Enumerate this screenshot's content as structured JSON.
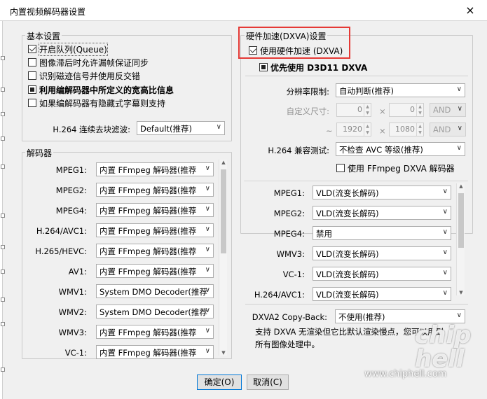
{
  "window": {
    "title": "内置视频解码器设置",
    "close_icon": "×"
  },
  "basic": {
    "title": "基本设置",
    "options": [
      {
        "label": "开启队列(Queue)",
        "state": "checked"
      },
      {
        "label": "图像滞后时允许漏帧保证同步",
        "state": "unchecked"
      },
      {
        "label": "识别磁迹信号并使用反交错",
        "state": "unchecked"
      },
      {
        "label": "利用编解码器中所定义的宽高比信息",
        "state": "indeterminate"
      },
      {
        "label": "如果编解码器有隐藏式字幕则支持",
        "state": "unchecked"
      }
    ],
    "deblock_label": "H.264 连续去块滤波:",
    "deblock_value": "Default(推荐)"
  },
  "decoders": {
    "title": "解码器",
    "rows": [
      {
        "label": "MPEG1:",
        "value": "内置 FFmpeg 解码器(推荐"
      },
      {
        "label": "MPEG2:",
        "value": "内置 FFmpeg 解码器(推荐"
      },
      {
        "label": "MPEG4:",
        "value": "内置 FFmpeg 解码器(推荐"
      },
      {
        "label": "H.264/AVC1:",
        "value": "内置 FFmpeg 解码器(推荐"
      },
      {
        "label": "H.265/HEVC:",
        "value": "内置 FFmpeg 解码器(推荐"
      },
      {
        "label": "AV1:",
        "value": "内置 FFmpeg 解码器(推荐"
      },
      {
        "label": "WMV1:",
        "value": "System DMO Decoder(推荐"
      },
      {
        "label": "WMV2:",
        "value": "System DMO Decoder(推荐"
      },
      {
        "label": "WMV3:",
        "value": "内置 FFmpeg 解码器(推荐"
      },
      {
        "label": "VC-1:",
        "value": "内置 FFmpeg 解码器(推荐"
      }
    ]
  },
  "hw": {
    "title": "硬件加速(DXVA)设置",
    "enable_label": "使用硬件加速 (DXVA)",
    "d3d11_label": "优先使用 D3D11 DXVA",
    "resolution_label": "分辨率限制:",
    "resolution_value": "自动判断(推荐)",
    "custom_size_label": "自定义尺寸:",
    "min_w": "0",
    "min_h": "0",
    "max_w": "1920",
    "max_h": "1080",
    "times": "×",
    "tilde": "~",
    "and1": "AND",
    "and2": "AND",
    "compat_label": "H.264 兼容测试:",
    "compat_value": "不检查 AVC 等级(推荐)",
    "ffmpeg_dxva_label": "使用 FFmpeg DXVA 解码器",
    "codec_rows": [
      {
        "label": "MPEG1:",
        "value": "VLD(流变长解码)"
      },
      {
        "label": "MPEG2:",
        "value": "VLD(流变长解码)"
      },
      {
        "label": "MPEG4:",
        "value": "禁用"
      },
      {
        "label": "WMV3:",
        "value": "VLD(流变长解码)"
      },
      {
        "label": "VC-1:",
        "value": "VLD(流变长解码)"
      },
      {
        "label": "H.264/AVC1:",
        "value": "VLD(流变长解码)"
      }
    ],
    "copyback_label": "DXVA2 Copy-Back:",
    "copyback_value": "不使用(推荐)",
    "note_line1": "支持 DXVA 无渲染但它比默认渲染慢点，您可以用到",
    "note_line2": "所有图像处理中。"
  },
  "buttons": {
    "ok": "确定(O)",
    "cancel": "取消(C)"
  },
  "watermark": {
    "logo": "chip hell",
    "url": "www.chiphell.com"
  },
  "colors": {
    "highlight_red": "#e53935",
    "default_btn": "#0078d7"
  }
}
